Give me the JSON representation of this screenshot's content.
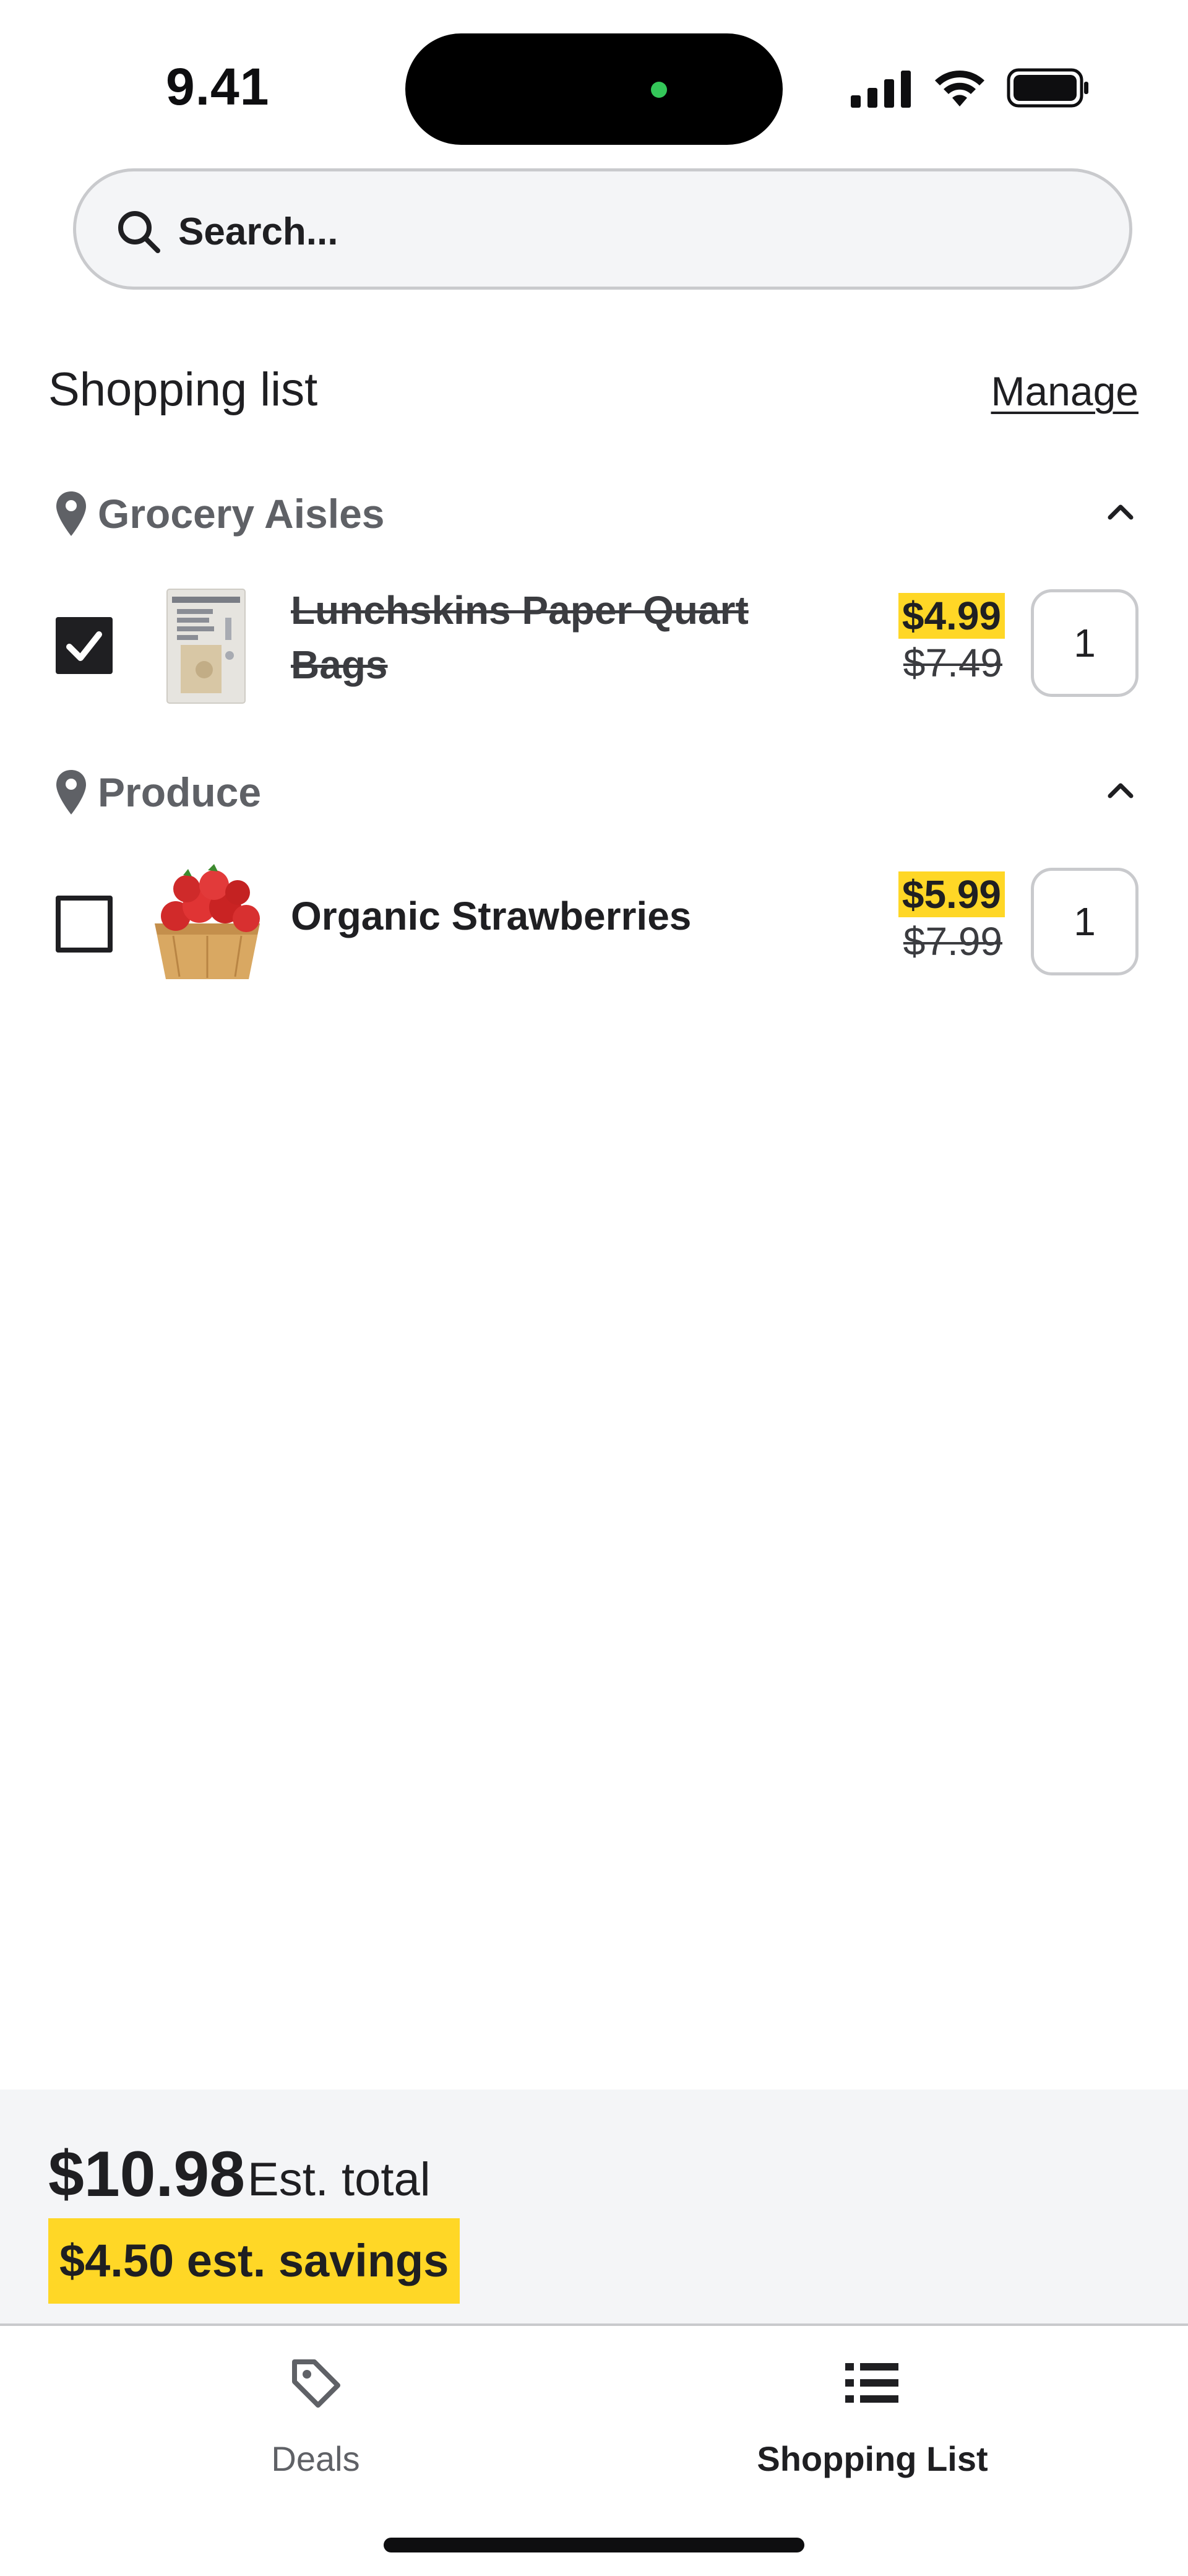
{
  "status_bar": {
    "time": "9.41",
    "icons": [
      "cellular-signal-icon",
      "wifi-icon",
      "battery-icon"
    ]
  },
  "search": {
    "placeholder": "Search..."
  },
  "header": {
    "title": "Shopping list",
    "manage_label": "Manage"
  },
  "sections": [
    {
      "label": "Grocery Aisles",
      "items": [
        {
          "name": "Lunchskins Paper Quart Bags",
          "sale_price": "$4.99",
          "original_price": "$7.49",
          "quantity": "1",
          "checked": true
        }
      ]
    },
    {
      "label": "Produce",
      "items": [
        {
          "name": "Organic Strawberries",
          "sale_price": "$5.99",
          "original_price": "$7.99",
          "quantity": "1",
          "checked": false
        }
      ]
    }
  ],
  "summary": {
    "total": "$10.98",
    "total_label": "Est. total",
    "savings": "$4.50 est. savings"
  },
  "nav": {
    "items": [
      {
        "label": "Deals",
        "icon": "tag-icon",
        "active": false
      },
      {
        "label": "Shopping List",
        "icon": "list-icon",
        "active": true
      }
    ]
  },
  "colors": {
    "highlight": "#ffd726",
    "text": "#1f1f22",
    "muted": "#5f6166",
    "border": "#c9cacd",
    "panel": "#f4f5f7"
  }
}
